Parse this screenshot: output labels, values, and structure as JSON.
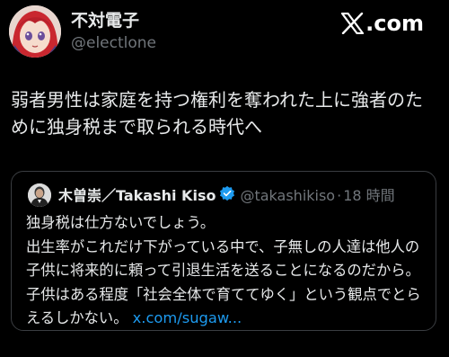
{
  "author": {
    "name": "不対電子",
    "handle": "@electlone"
  },
  "brand": {
    "label": ".com",
    "icon": "x-logo-icon"
  },
  "post": {
    "text": "弱者男性は家庭を持つ権利を奪われた上に強者のために独身税まで取られる時代へ"
  },
  "quoted_post": {
    "name": "木曽崇／Takashi Kiso",
    "handle": "@takashikiso",
    "separator": "·",
    "time": "18 時間",
    "text": "独身税は仕方ないでしょう。\n出生率がこれだけ下がっている中で、子無しの人達は他人の子供に将来的に頼って引退生活を送ることになるのだから。子供はある程度「社会全体で育ててゆく」という観点でとらえるしかない。 ",
    "link": "x.com/sugaw...",
    "verified_icon": "verified-badge-icon"
  },
  "colors": {
    "background": "#000000",
    "text": "#e7e9ea",
    "muted": "#71767b",
    "link": "#1d9bf0",
    "border": "#3a3d41"
  }
}
